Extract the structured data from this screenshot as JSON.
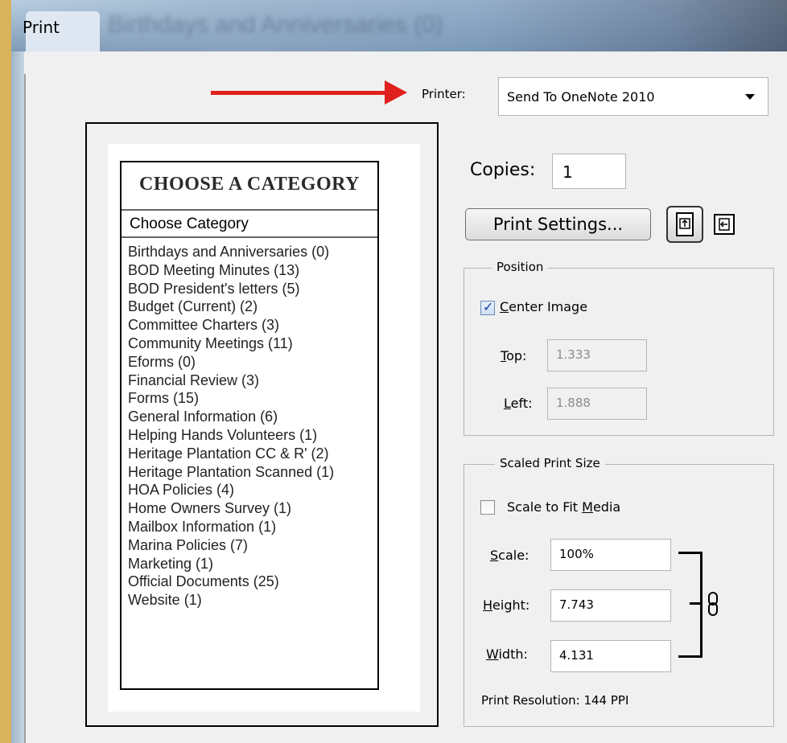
{
  "window": {
    "title": "Print",
    "background_title_blurred": "Birthdays and Anniversaries (0)"
  },
  "printer": {
    "label": "Printer:",
    "selected": "Send To OneNote 2010"
  },
  "preview": {
    "heading": "CHOOSE A CATEGORY",
    "select_label": "Choose Category",
    "categories": [
      "Birthdays and Anniversaries (0)",
      "BOD Meeting Minutes (13)",
      "BOD President's letters (5)",
      "Budget (Current) (2)",
      "Committee Charters (3)",
      "Community Meetings (11)",
      "Eforms (0)",
      "Financial Review (3)",
      "Forms (15)",
      "General Information (6)",
      "Helping Hands Volunteers (1)",
      "Heritage Plantation CC & R' (2)",
      "Heritage Plantation Scanned (1)",
      "HOA Policies (4)",
      "Home Owners Survey (1)",
      "Mailbox Information (1)",
      "Marina Policies (7)",
      "Marketing (1)",
      "Official Documents (25)",
      "Website (1)"
    ]
  },
  "copies": {
    "label": "Copies:",
    "value": "1"
  },
  "print_settings": {
    "label": "Print Settings..."
  },
  "position": {
    "legend": "Position",
    "center_image": {
      "label_first": "C",
      "label_rest": "enter Image",
      "checked": true
    },
    "top": {
      "label_first": "T",
      "label_rest": "op:",
      "value": "1.333"
    },
    "left": {
      "label_first": "L",
      "label_rest": "eft:",
      "value": "1.888"
    }
  },
  "scaled": {
    "legend": "Scaled Print Size",
    "scale_to_fit": {
      "label_before": "Scale to Fit ",
      "label_u": "M",
      "label_after": "edia",
      "checked": false
    },
    "scale": {
      "label_first": "S",
      "label_rest": "cale:",
      "value": "100%"
    },
    "height": {
      "label_first": "H",
      "label_rest": "eight:",
      "value": "7.743"
    },
    "width": {
      "label_first": "W",
      "label_rest": "idth:",
      "value": "4.131"
    },
    "resolution": "Print Resolution: 144 PPI"
  },
  "colors": {
    "arrow": "#e0201c",
    "desktop": "#d8b35c",
    "dialog": "#f0f0f0"
  },
  "icons": {
    "arrow": "red-arrow-icon",
    "portrait": "portrait-orientation-icon",
    "landscape": "landscape-orientation-icon",
    "link": "chain-link-icon",
    "dropdown": "chevron-down-icon"
  }
}
